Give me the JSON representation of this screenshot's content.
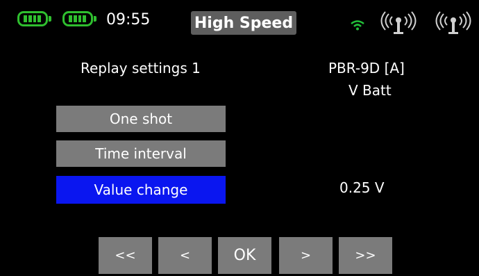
{
  "status_bar": {
    "battery_1": {
      "icon": "battery-icon",
      "color": "#2fbf2f",
      "level": 1.0
    },
    "battery_2": {
      "icon": "battery-icon",
      "color": "#2fbf2f",
      "level": 1.0
    },
    "time": "09:55",
    "mode": "High Speed",
    "wifi_icon": "wifi-icon",
    "wifi_color": "#22c03a",
    "antenna_icons": [
      "antenna-icon",
      "antenna-icon"
    ]
  },
  "screen": {
    "title": "Replay settings 1",
    "device": "PBR-9D [A]",
    "sensor": "V Batt",
    "value": "0.25 V"
  },
  "options": [
    {
      "label": "One shot",
      "selected": false
    },
    {
      "label": "Time interval",
      "selected": false
    },
    {
      "label": "Value change",
      "selected": true
    }
  ],
  "selected_color": "#0a16f0",
  "nav": [
    "<<",
    "<",
    "OK",
    ">",
    ">>"
  ]
}
